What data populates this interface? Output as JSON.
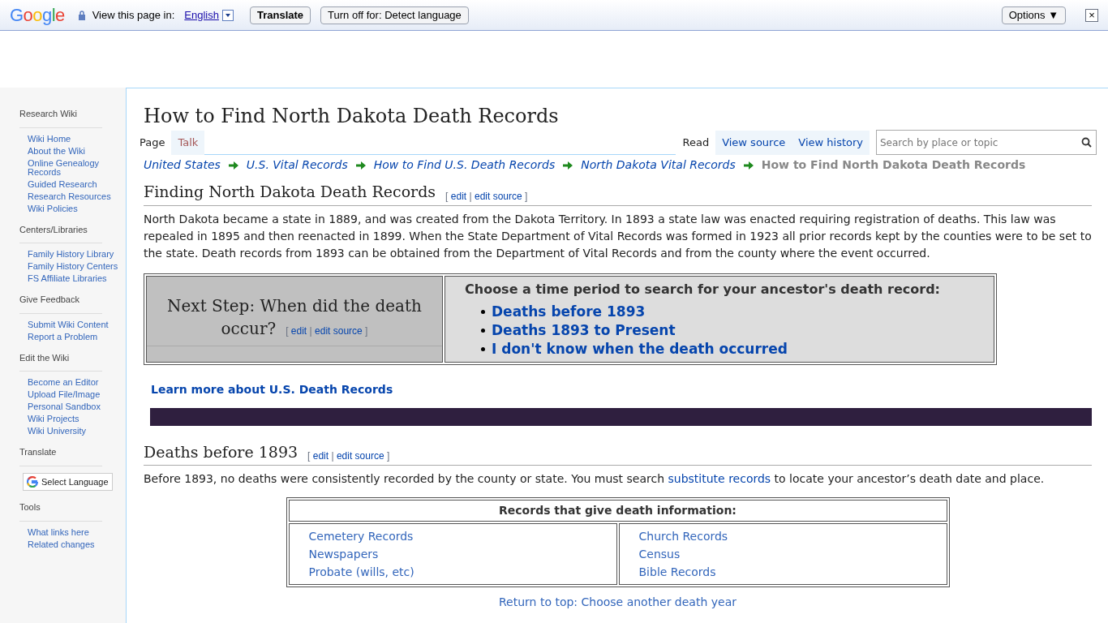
{
  "translate_bar": {
    "brand": "Google",
    "prompt": "View this page in:",
    "language": "English",
    "translate_button": "Translate",
    "turn_off_button": "Turn off for: Detect language",
    "options_button": "Options ▼",
    "close": "×"
  },
  "sidebar": [
    {
      "heading": "Research Wiki",
      "links": [
        "Wiki Home",
        "About the Wiki",
        "Online Genealogy Records",
        "Guided Research",
        "Research Resources",
        "Wiki Policies"
      ]
    },
    {
      "heading": "Centers/Libraries",
      "links": [
        "Family History Library",
        "Family History Centers",
        "FS Affiliate Libraries"
      ]
    },
    {
      "heading": "Give Feedback",
      "links": [
        "Submit Wiki Content",
        "Report a Problem"
      ]
    },
    {
      "heading": "Edit the Wiki",
      "links": [
        "Become an Editor",
        "Upload File/Image",
        "Personal Sandbox",
        "Wiki Projects",
        "Wiki University"
      ]
    },
    {
      "heading": "Translate",
      "select_language": "Select Language"
    },
    {
      "heading": "Tools",
      "links": [
        "What links here",
        "Related changes"
      ]
    }
  ],
  "page_tabs": [
    {
      "label": "Page",
      "selected": true
    },
    {
      "label": "Talk",
      "selected": false
    }
  ],
  "view_tabs": [
    {
      "label": "Read",
      "selected": true
    },
    {
      "label": "View source",
      "selected": false
    },
    {
      "label": "View history",
      "selected": false
    }
  ],
  "search": {
    "placeholder": "Search by place or topic"
  },
  "title": "How to Find North Dakota Death Records",
  "breadcrumb": [
    "United States",
    "U.S. Vital Records",
    "How to Find U.S. Death Records",
    "North Dakota Vital Records",
    "How to Find North Dakota Death Records"
  ],
  "section1": {
    "heading": "Finding North Dakota Death Records",
    "edit_links": {
      "open": "[",
      "edit": "edit",
      "sep": "|",
      "edit_source": "edit source",
      "close": "]"
    },
    "text": "North Dakota became a state in 1889, and was created from the Dakota Territory. In 1893 a state law was enacted requiring registration of deaths. This law was repealed in 1895 and then reenacted in 1899. When the State Department of Vital Records was formed in 1923 all prior records kept by the counties were to be set to the state. Death records from 1893 can be obtained from the Department of Vital Records and from the county where the event occurred."
  },
  "next_step": {
    "heading_lines": [
      "Next Step: When did the death",
      "occur?"
    ],
    "edit_links": {
      "open": "[",
      "edit": "edit",
      "sep": "|",
      "edit_source": "edit source",
      "close": "]"
    },
    "prompt": "Choose a time period to search for your ancestor's death record:",
    "options": [
      "Deaths before 1893",
      "Deaths 1893 to Present",
      "I don't know when the death occurred"
    ]
  },
  "learn_more": "Learn more about U.S. Death Records",
  "section2": {
    "heading": "Deaths before 1893",
    "edit_links": {
      "open": "[",
      "edit": "edit",
      "sep": "|",
      "edit_source": "edit source",
      "close": "]"
    },
    "text_before": "Before 1893, no deaths were consistently recorded by the county or state. You must search",
    "link": "substitute records",
    "text_after": "to locate your ancestor’s death date and place."
  },
  "records_table": {
    "caption": "Records that give death information:",
    "columns": [
      [
        "Cemetery Records",
        "Newspapers",
        "Probate (wills, etc)"
      ],
      [
        "Church Records",
        "Census",
        "Bible Records"
      ]
    ]
  },
  "return_link": "Return to top: Choose another death year"
}
